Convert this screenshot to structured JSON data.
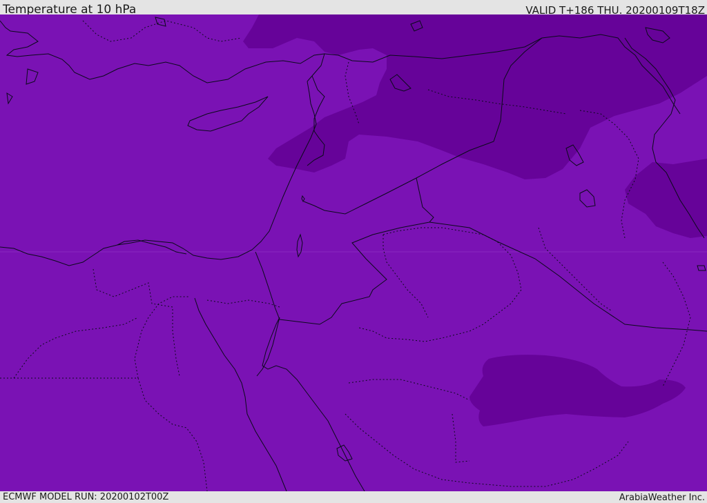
{
  "header": {
    "title": "Temperature at 10 hPa",
    "valid": "VALID T+186 THU. 20200109T18Z"
  },
  "footer": {
    "model_run": "ECMWF MODEL RUN: 20200102T00Z",
    "credit": "ArabiaWeather Inc."
  },
  "map": {
    "field_colors": {
      "base": "#7a12b4",
      "cold": "#660399"
    },
    "line_color": "#0a0a1a"
  }
}
